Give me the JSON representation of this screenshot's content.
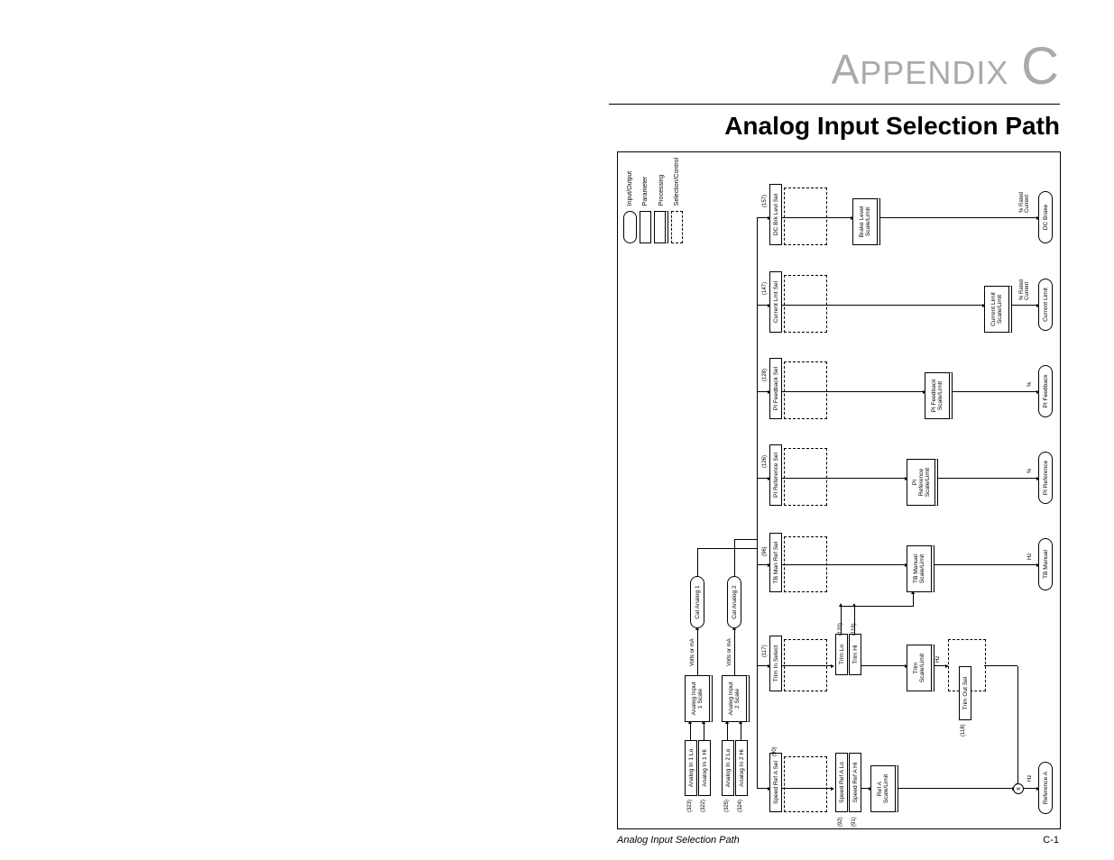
{
  "header": {
    "appendix": "APPENDIX",
    "appendix_letter": "C",
    "subtitle": "Analog  Input Selection Path"
  },
  "legend": {
    "io": "Input/Output",
    "param": "Parameter",
    "proc": "Processing",
    "sel": "Selection/Control"
  },
  "inputs": {
    "ai1lo": "Analog In 1 Lo",
    "ai1lo_num": "(323)",
    "ai1hi": "Analog In 1 Hi",
    "ai1hi_num": "(322)",
    "ai2lo": "Analog In 2 Lo",
    "ai2lo_num": "(325)",
    "ai2hi": "Analog In 2 Hi",
    "ai2hi_num": "(324)",
    "ai1scale": "Analog Input\n1 Scale",
    "ai2scale": "Analog Input\n2 Scale",
    "volts_or_ma": "Volts or mA",
    "cal1": "Cal Analog 1",
    "cal2": "Cal Analog 2"
  },
  "sels": {
    "speedrefa": "Speed Ref A Sel",
    "speedrefa_num": "(90)",
    "trimin": "Trim In Select",
    "trimin_num": "(117)",
    "tbman": "TB Man Ref Sel",
    "tbman_num": "(96)",
    "piref": "PI Reference Sel",
    "piref_num": "(126)",
    "pifdbk": "PI Feedback Sel",
    "pifdbk_num": "(128)",
    "curlim": "Current Lmt Sel",
    "curlim_num": "(147)",
    "dcbrk": "DC Brk Levl Sel",
    "dcbrk_num": "(157)",
    "trimout": "Trim Out Sel",
    "trimout_num": "(118)"
  },
  "params": {
    "speedrefalo": "Speed Ref A Lo",
    "speedrefalo_num": "(92)",
    "speedrefahi": "Speed Ref A Hi",
    "speedrefahi_num": "(91)",
    "trimlo": "Trim Lo",
    "trimlo_num": "(120)",
    "trimhi": "Trim Hi",
    "trimhi_num": "(119)"
  },
  "procs": {
    "refascale": "Ref A\nScale/Limit",
    "trimscale": "Trim\nScale/Limit",
    "tbmanscale": "TB Manual\nScale/Limit",
    "pirefscale": "PI\nReference\nScale/Limit",
    "pifdbkscale": "PI Feedback\nScale/Limit",
    "curlimscale": "Current Limit\nScale/Limit",
    "brakescale": "Brake Level\nScale/Limit"
  },
  "outputs": {
    "refa": "Reference A",
    "tbman": "TB Manual",
    "piref": "PI Reference",
    "pifdbk": "PI Feedback",
    "curlim": "Current Limit",
    "dcbrake": "DC Brake"
  },
  "units": {
    "hz": "Hz",
    "pct": "%",
    "pct_rated_current": "% Rated\nCurrent"
  },
  "mult": "x",
  "footer": {
    "title": "Analog Input Selection Path",
    "page": "C-1"
  }
}
